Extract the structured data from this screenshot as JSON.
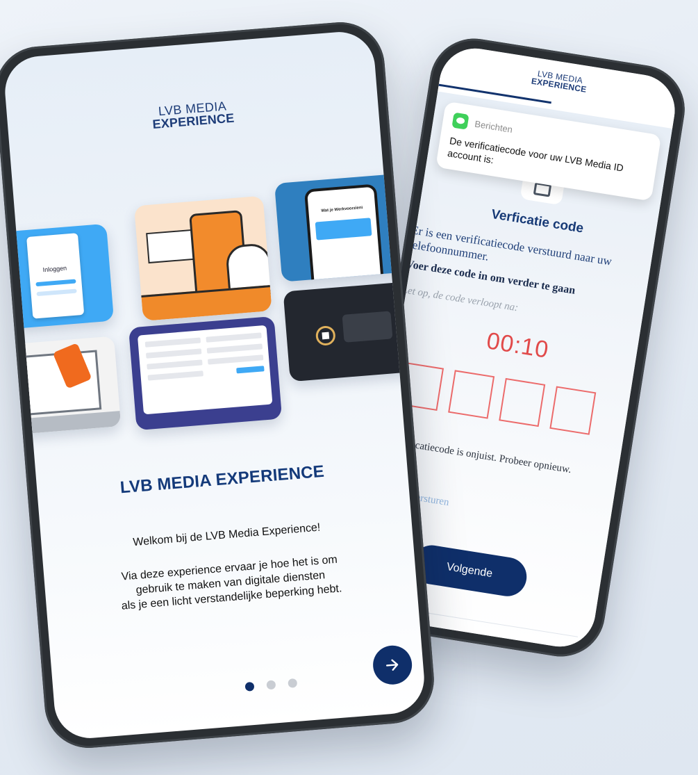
{
  "front_phone": {
    "logo": {
      "line1": "LVB MEDIA",
      "line2": "EXPERIENCE"
    },
    "tiles": [
      {
        "name": "tile-login-screen",
        "label": "Inloggen"
      },
      {
        "name": "tile-hand-phone-illustration"
      },
      {
        "name": "tile-phone-app",
        "label": "Wat je Werkvoorzieni"
      },
      {
        "name": "tile-laptop-phone-illustration"
      },
      {
        "name": "tile-form-screenshot"
      },
      {
        "name": "tile-dark-flow"
      }
    ],
    "title": "LVB MEDIA EXPERIENCE",
    "welcome": "Welkom bij de LVB Media Experience!",
    "body": "Via deze experience ervaar je hoe het is om\ngebruik te maken van digitale diensten\nals je een licht verstandelijke beperking hebt.",
    "pagination": {
      "total": 3,
      "active": 0
    },
    "next_icon": "arrow-right-icon"
  },
  "back_phone": {
    "logo": {
      "line1": "LVB MEDIA",
      "line2": "EXPERIENCE"
    },
    "notification": {
      "app": "Berichten",
      "text": "De verificatiecode voor uw LVB Media ID account is:"
    },
    "title": "Verficatie code",
    "description": "Er is een verificatiecode verstuurd naar uw telefoonnummer.",
    "instruction": "Voer deze code in om verder te gaan",
    "expiry_label": "Let op, de code verloopt na:",
    "timer": "00:10",
    "code_boxes": [
      "",
      "",
      "",
      ""
    ],
    "error": "De verificatiecode is onjuist. Probeer opnieuw.",
    "resend_link": "Opnieuw versturen",
    "next_button": "Volgende"
  },
  "colors": {
    "brand_navy": "#0f2f6a",
    "logo_blue": "#1d3c78",
    "timer_red": "#e14a4a",
    "box_border": "#ec6b6b",
    "message_green": "#3fd05a"
  }
}
